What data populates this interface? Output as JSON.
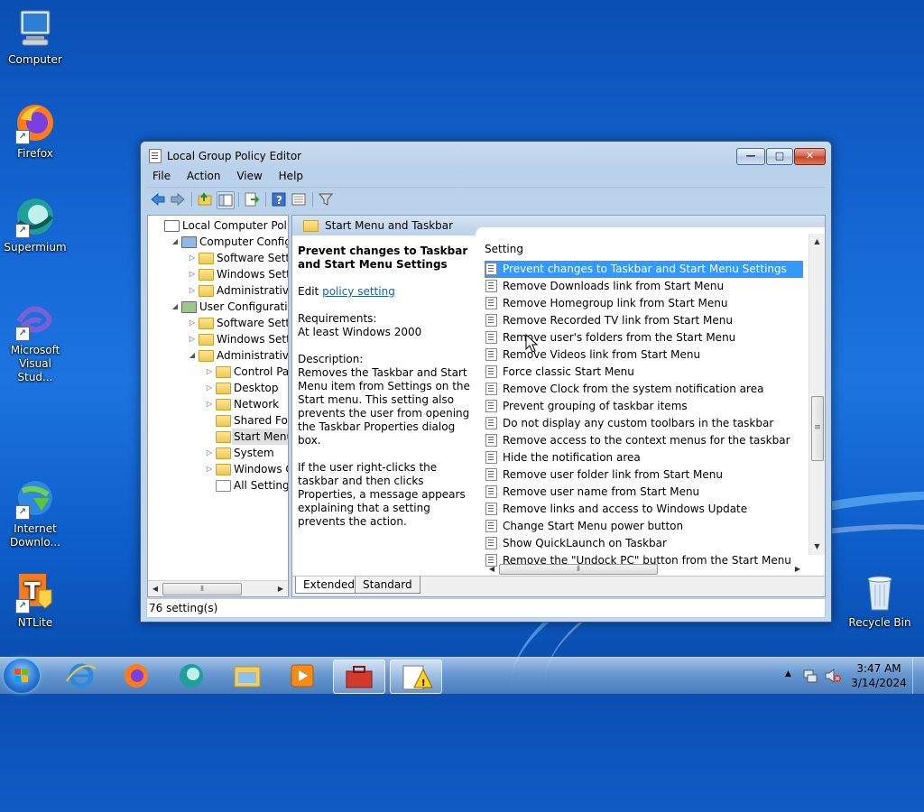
{
  "desktop": {
    "icons": [
      {
        "label": "Computer"
      },
      {
        "label": "Firefox"
      },
      {
        "label": "Supermium"
      },
      {
        "label": "Microsoft Visual Stud..."
      },
      {
        "label": "Internet Downlo..."
      },
      {
        "label": "NTLite"
      },
      {
        "label": "Recycle Bin"
      }
    ]
  },
  "window": {
    "title": "Local Group Policy Editor",
    "controls": {
      "minimize": "—",
      "maximize": "□",
      "close": "✕"
    },
    "menu": [
      "File",
      "Action",
      "View",
      "Help"
    ],
    "tree": [
      {
        "label": "Local Computer Policy"
      },
      {
        "label": "Computer Configura"
      },
      {
        "label": "Software Settings"
      },
      {
        "label": "Windows Setting"
      },
      {
        "label": "Administrative Te"
      },
      {
        "label": "User Configuration"
      },
      {
        "label": "Software Settings"
      },
      {
        "label": "Windows Setting"
      },
      {
        "label": "Administrative Te"
      },
      {
        "label": "Control Panel"
      },
      {
        "label": "Desktop"
      },
      {
        "label": "Network"
      },
      {
        "label": "Shared Folder"
      },
      {
        "label": "Start Menu ar"
      },
      {
        "label": "System"
      },
      {
        "label": "Windows Cor"
      },
      {
        "label": "All Settings"
      }
    ],
    "right_header": "Start Menu and Taskbar",
    "description": {
      "title": "Prevent changes to Taskbar and Start Menu Settings",
      "edit_prefix": "Edit",
      "edit_link": "policy setting",
      "requirements_label": "Requirements:",
      "requirements_value": "At least Windows 2000",
      "description_label": "Description:",
      "description_text": "Removes the Taskbar and Start Menu item from Settings on the Start menu. This setting also prevents the user from opening the Taskbar Properties dialog box.",
      "description_text2": "If the user right-clicks the taskbar and then clicks Properties, a message appears explaining that a setting prevents the action."
    },
    "column_header": "Setting",
    "settings": [
      "Prevent changes to Taskbar and Start Menu Settings",
      "Remove Downloads link from Start Menu",
      "Remove Homegroup link from Start Menu",
      "Remove Recorded TV link from Start Menu",
      "Remove user's folders from the Start Menu",
      "Remove Videos link from Start Menu",
      "Force classic Start Menu",
      "Remove Clock from the system notification area",
      "Prevent grouping of taskbar items",
      "Do not display any custom toolbars in the taskbar",
      "Remove access to the context menus for the taskbar",
      "Hide the notification area",
      "Remove user folder link from Start Menu",
      "Remove user name from Start Menu",
      "Remove links and access to Windows Update",
      "Change Start Menu power button",
      "Show QuickLaunch on Taskbar",
      "Remove the \"Undock PC\" button from the Start Menu"
    ],
    "tabs": [
      "Extended",
      "Standard"
    ],
    "status": "76 setting(s)"
  },
  "taskbar": {
    "time": "3:47 AM",
    "date": "3/14/2024"
  },
  "colors": {
    "selection": "#3399ff",
    "link": "#1a5fb4"
  }
}
